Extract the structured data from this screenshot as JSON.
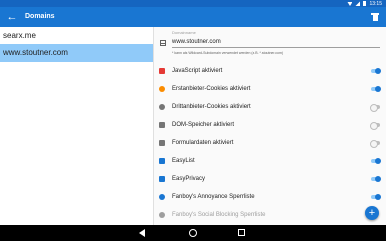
{
  "status_bar": {
    "time": "13:15"
  },
  "app_bar": {
    "title": "Domains"
  },
  "domains": [
    {
      "label": "searx.me"
    },
    {
      "label": "www.stoutner.com"
    }
  ],
  "detail": {
    "domain_label": "Domainname",
    "domain_value": "www.stoutner.com",
    "hint": "* kann als Wildcard-Subdomain verwendet werden (z.B. *.stoutner.com)",
    "settings": [
      {
        "label": "JavaScript aktiviert",
        "icon": "javascript-icon",
        "color": "#e53935",
        "state": "on"
      },
      {
        "label": "Erstanbieter-Cookies aktiviert",
        "icon": "cookie-icon",
        "color": "#fb8c00",
        "state": "on"
      },
      {
        "label": "Drittanbieter-Cookies aktiviert",
        "icon": "third-party-cookie-icon",
        "color": "#757575",
        "state": "off"
      },
      {
        "label": "DOM-Speicher aktiviert",
        "icon": "dom-storage-icon",
        "color": "#757575",
        "state": "off"
      },
      {
        "label": "Formulardaten aktiviert",
        "icon": "form-data-icon",
        "color": "#757575",
        "state": "off"
      },
      {
        "label": "EasyList",
        "icon": "easylist-icon",
        "color": "#1976d2",
        "state": "on"
      },
      {
        "label": "EasyPrivacy",
        "icon": "easyprivacy-icon",
        "color": "#1976d2",
        "state": "on"
      },
      {
        "label": "Fanboy's Annoyance Sperrliste",
        "icon": "fanboy-annoyance-icon",
        "color": "#1976d2",
        "state": "on"
      },
      {
        "label": "Fanboy's Social Blocking Sperrliste",
        "icon": "fanboy-social-icon",
        "color": "#9e9e9e",
        "state": "disabled"
      }
    ]
  },
  "fab": {
    "label": "+"
  },
  "colors": {
    "primary": "#1976d2",
    "primary_dark": "#1565c0",
    "selected": "#90caf9"
  }
}
